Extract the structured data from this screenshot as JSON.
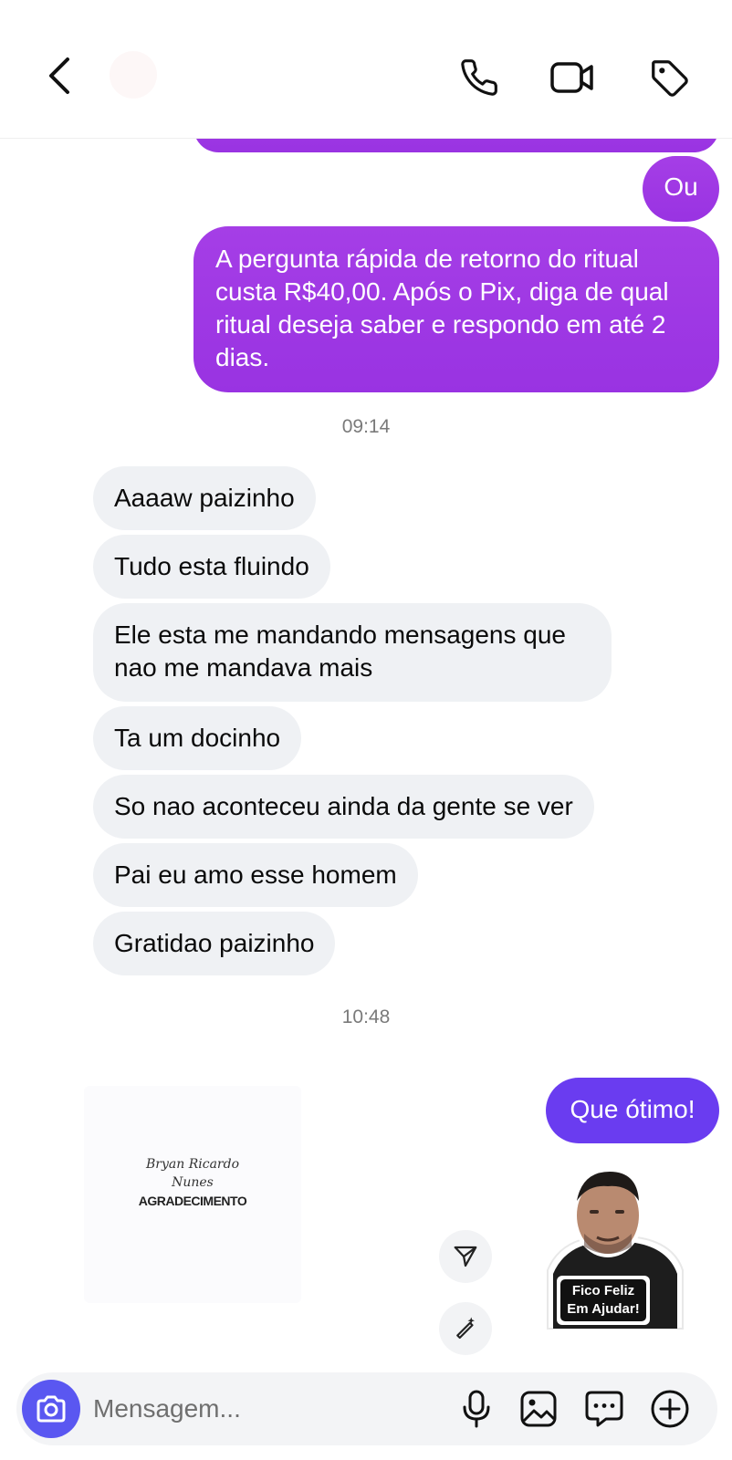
{
  "header": {
    "back_icon": "chevron-left-icon",
    "call_icon": "phone-icon",
    "video_icon": "video-camera-icon",
    "tag_icon": "tag-icon"
  },
  "messages": {
    "outgoing_short": "Ou",
    "outgoing_long": "A pergunta rápida de retorno do ritual custa R$40,00. Após o Pix, diga de qual ritual deseja saber e respondo em até 2 dias.",
    "timestamp_1": "09:14",
    "incoming": [
      "Aaaaw paizinho",
      "Tudo esta fluindo",
      "Ele esta me mandando mensagens que nao me mandava mais",
      "Ta um docinho",
      "So nao aconteceu ainda da gente se ver",
      "Pai eu amo esse homem",
      "Gratidao paizinho"
    ],
    "timestamp_2": "10:48",
    "outgoing_reply": "Que ótimo!"
  },
  "shared_card": {
    "script_line_1": "Bryan Ricardo",
    "script_line_2": "Nunes",
    "title": "AGRADECIMENTO"
  },
  "sticker": {
    "caption_line_1": "Fico Feliz",
    "caption_line_2": "Em Ajudar!"
  },
  "composer": {
    "placeholder": "Mensagem...",
    "camera_icon": "camera-icon",
    "mic_icon": "microphone-icon",
    "gallery_icon": "image-icon",
    "chat_icon": "chat-bubble-icon",
    "plus_icon": "plus-circle-icon"
  },
  "colors": {
    "outgoing_bubble": "#9f39e4",
    "outgoing_reply_bubble": "#6a3cf0",
    "incoming_bubble": "#eff1f4",
    "camera_button": "#5a57f1"
  }
}
